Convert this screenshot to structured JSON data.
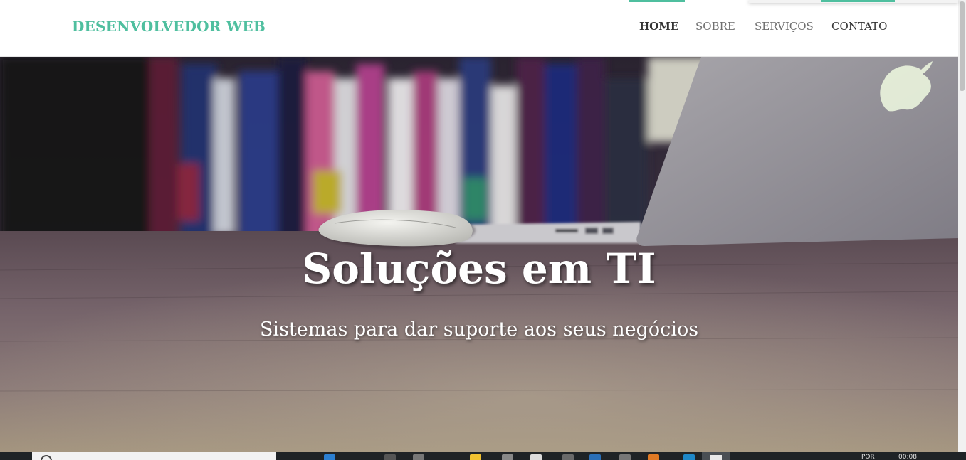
{
  "header": {
    "brand": "DESENVOLVEDOR WEB",
    "nav": [
      {
        "label": "HOME"
      },
      {
        "label": "SOBRE"
      },
      {
        "label": "SERVIÇOS"
      },
      {
        "label": "CONTATO"
      }
    ],
    "accent_color": "#4fbf9f"
  },
  "hero": {
    "title": "Soluções em TI",
    "subtitle": "Sistemas para dar suporte aos seus negócios",
    "background": "blurred-bookshelf-desk-mouse-laptop-photo"
  },
  "taskbar": {
    "language": "POR",
    "clock": "00:08"
  }
}
